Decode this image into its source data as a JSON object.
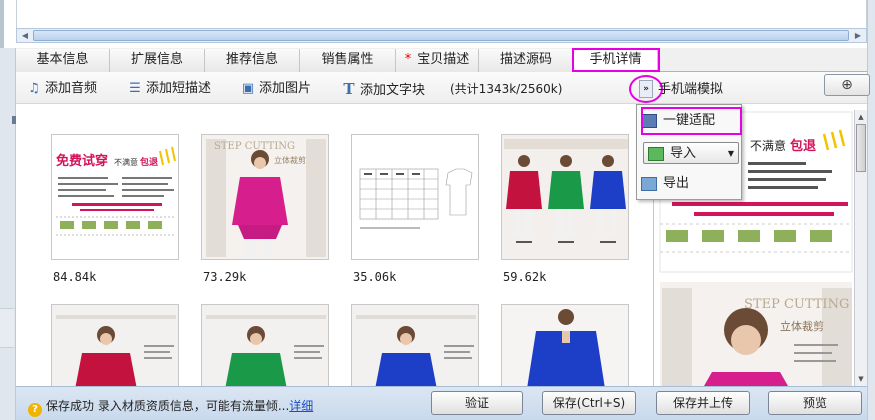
{
  "tabs": [
    {
      "label": "基本信息",
      "active": false,
      "required": false
    },
    {
      "label": "扩展信息",
      "active": false,
      "required": false
    },
    {
      "label": "推荐信息",
      "active": false,
      "required": false
    },
    {
      "label": "销售属性",
      "active": false,
      "required": false
    },
    {
      "label": "宝贝描述",
      "active": false,
      "required": true
    },
    {
      "label": "描述源码",
      "active": false,
      "required": false
    },
    {
      "label": "手机详情",
      "active": true,
      "required": false
    }
  ],
  "tabs_required_marker": "*",
  "toolbar": {
    "add_audio": "添加音频",
    "add_short_desc": "添加短描述",
    "add_image": "添加图片",
    "add_text": "添加文字块",
    "size_summary": "(共计1343k/2560k)",
    "expand_label": "»",
    "mobile_preview_title": "手机端模拟"
  },
  "thumbnails": [
    {
      "size": "84.84k",
      "kind": "promo-banner",
      "promo_text": "免费试穿",
      "promo_sub": "不满意",
      "promo_tag": "包退"
    },
    {
      "size": "73.29k",
      "kind": "model-pink",
      "overlay_text": "STEP CUTTING",
      "overlay_sub": "立体裁剪"
    },
    {
      "size": "35.06k",
      "kind": "size-chart"
    },
    {
      "size": "59.62k",
      "kind": "color-trio"
    },
    {
      "size": "",
      "kind": "model-pink-cutoff"
    },
    {
      "size": "",
      "kind": "model-green"
    },
    {
      "size": "",
      "kind": "model-blue"
    },
    {
      "size": "",
      "kind": "model-blue-solo"
    }
  ],
  "preview": {
    "promo_sub": "不满意",
    "promo_tag": "包退",
    "overlay_text": "STEP CUTTING",
    "overlay_sub": "立体裁剪"
  },
  "menu": {
    "one_click_fit": "一键适配",
    "import": "导入",
    "export": "导出"
  },
  "status": {
    "message": "保存成功 录入材质资质信息，可能有流量倾...",
    "link": "详细"
  },
  "buttons": {
    "verify": "验证",
    "save": "保存(Ctrl+S)",
    "save_upload": "保存并上传",
    "preview": "预览"
  },
  "colors": {
    "highlight": "#e600e6",
    "accent_blue": "#3a6fb0",
    "status_bg": "#c9d9ec",
    "promo_red": "#d4145a"
  }
}
